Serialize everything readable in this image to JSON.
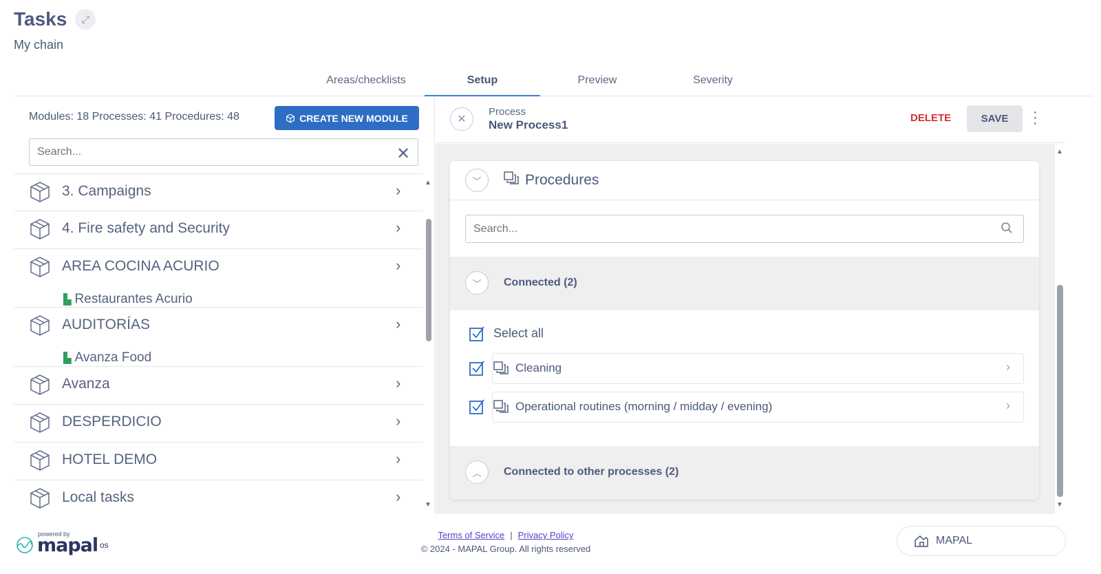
{
  "page": {
    "title": "Tasks",
    "subtitle": "My chain"
  },
  "tabs": [
    {
      "label": "Areas/checklists",
      "active": false
    },
    {
      "label": "Setup",
      "active": true
    },
    {
      "label": "Preview",
      "active": false
    },
    {
      "label": "Severity",
      "active": false
    }
  ],
  "left": {
    "counts": "Modules: 18 Processes: 41 Procedures: 48",
    "create_label": "CREATE NEW MODULE",
    "search_placeholder": "Search...",
    "modules": [
      {
        "name": "3. Campaigns",
        "org": ""
      },
      {
        "name": "4. Fire safety and Security",
        "org": ""
      },
      {
        "name": "AREA COCINA ACURIO",
        "org": "Restaurantes Acurio"
      },
      {
        "name": "AUDITORÍAS",
        "org": "Avanza Food"
      },
      {
        "name": "Avanza",
        "org": ""
      },
      {
        "name": "DESPERDICIO",
        "org": ""
      },
      {
        "name": "HOTEL DEMO",
        "org": ""
      },
      {
        "name": "Local tasks",
        "org": ""
      }
    ]
  },
  "process": {
    "label": "Process",
    "name": "New Process1",
    "delete_label": "DELETE",
    "save_label": "SAVE"
  },
  "procedures": {
    "title": "Procedures",
    "search_placeholder": "Search...",
    "connected_label": "Connected (2)",
    "select_all_label": "Select all",
    "items": [
      {
        "label": "Cleaning",
        "checked": true
      },
      {
        "label": "Operational routines (morning / midday / evening)",
        "checked": true
      }
    ],
    "other_label": "Connected to other processes (2)"
  },
  "footer": {
    "powered_by": "powered by",
    "logo_text": "mapal",
    "logo_suffix": "os",
    "terms": "Terms of Service",
    "separator": "|",
    "privacy": "Privacy Policy",
    "copyright": "© 2024 - MAPAL Group. All rights reserved",
    "chip_label": "MAPAL"
  },
  "colors": {
    "accent": "#2e6dc6",
    "danger": "#d3302f",
    "tab_indicator": "#3d7fd0"
  }
}
